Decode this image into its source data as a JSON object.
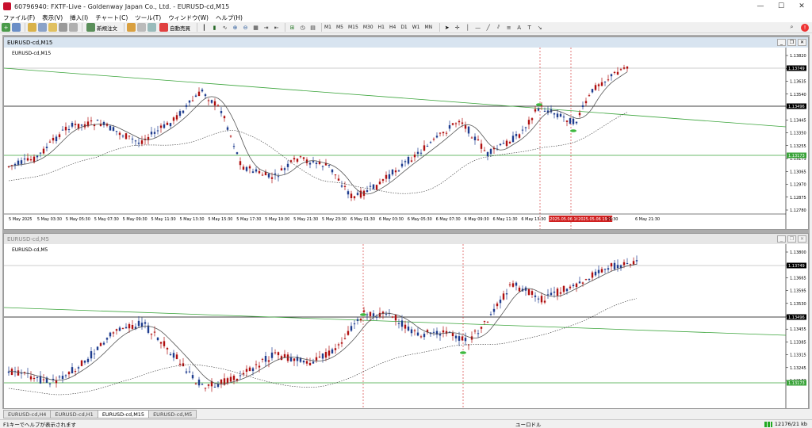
{
  "window": {
    "title": "60796940: FXTF-Live - Goldenway Japan Co., Ltd. - EURUSD-cd,M15",
    "minimize": "—",
    "maximize": "☐",
    "close": "✕"
  },
  "menu": [
    "ファイル(F)",
    "表示(V)",
    "挿入(I)",
    "チャート(C)",
    "ツール(T)",
    "ウィンドウ(W)",
    "ヘルプ(H)"
  ],
  "toolbar": {
    "new_order": "新規注文",
    "auto_trade": "自動売買",
    "timeframes": [
      "M1",
      "M5",
      "M15",
      "M30",
      "H1",
      "H4",
      "D1",
      "W1",
      "MN"
    ],
    "icons": [
      "new-chart-icon",
      "profiles-icon",
      "market-watch-icon",
      "navigator-icon",
      "terminal-icon",
      "tester-icon",
      "zoom-in-icon",
      "zoom-out-icon",
      "crosshair-icon",
      "line-icon",
      "fibonacci-icon",
      "text-icon"
    ]
  },
  "chart1": {
    "window_title": "EURUSD-cd,M15",
    "label": "EURUSD-cd,M15",
    "price_labels": [
      "1.13820",
      "1.13749",
      "1.13635",
      "1.13540",
      "1.13496",
      "1.13445",
      "1.13350",
      "1.13255",
      "1.13173",
      "1.13065",
      "1.12970",
      "1.12875",
      "1.12780"
    ],
    "time_labels": [
      "5 May 2025",
      "5 May 03:30",
      "5 May 05:30",
      "5 May 07:30",
      "5 May 09:30",
      "5 May 11:30",
      "5 May 13:30",
      "5 May 15:30",
      "5 May 17:30",
      "5 May 19:30",
      "5 May 21:30",
      "5 May 23:30",
      "6 May 01:30",
      "6 May 03:30",
      "6 May 05:30",
      "6 May 07:30",
      "6 May 09:30",
      "6 May 11:30",
      "6 May 13:30",
      "2025.05.06 16:4",
      "2025.05.06 19:15",
      "19:30",
      "6 May 21:30"
    ],
    "highlight_labels": [
      "2025.05.06 16:4",
      "2025.05.06 19:15"
    ],
    "black_price": "1.13496",
    "green_price": "1.13173",
    "current_price": "1.13749"
  },
  "chart2": {
    "window_title": "EURUSD-cd,M5",
    "label": "EURUSD-cd,M5",
    "price_labels": [
      "1.13800",
      "1.13749",
      "1.13665",
      "1.13595",
      "1.13530",
      "1.13496",
      "1.13455",
      "1.13385",
      "1.13315",
      "1.13245",
      "1.13173"
    ],
    "black_price": "1.13496",
    "green_price": "1.13173",
    "current_price": "1.13749"
  },
  "tabs": [
    "EURUSD-cd,H4",
    "EURUSD-cd,H1",
    "EURUSD-cd,M15",
    "EURUSD-cd,M5"
  ],
  "active_tab": "EURUSD-cd,M15",
  "status": {
    "hint": "F1キーでヘルプが表示されます",
    "profile": "ユーロドル",
    "traffic": "12176/21 kb"
  },
  "colors": {
    "bull": "#1f3d8f",
    "bear": "#b01010",
    "trend": "#3aa43a",
    "ma": "#555555"
  }
}
